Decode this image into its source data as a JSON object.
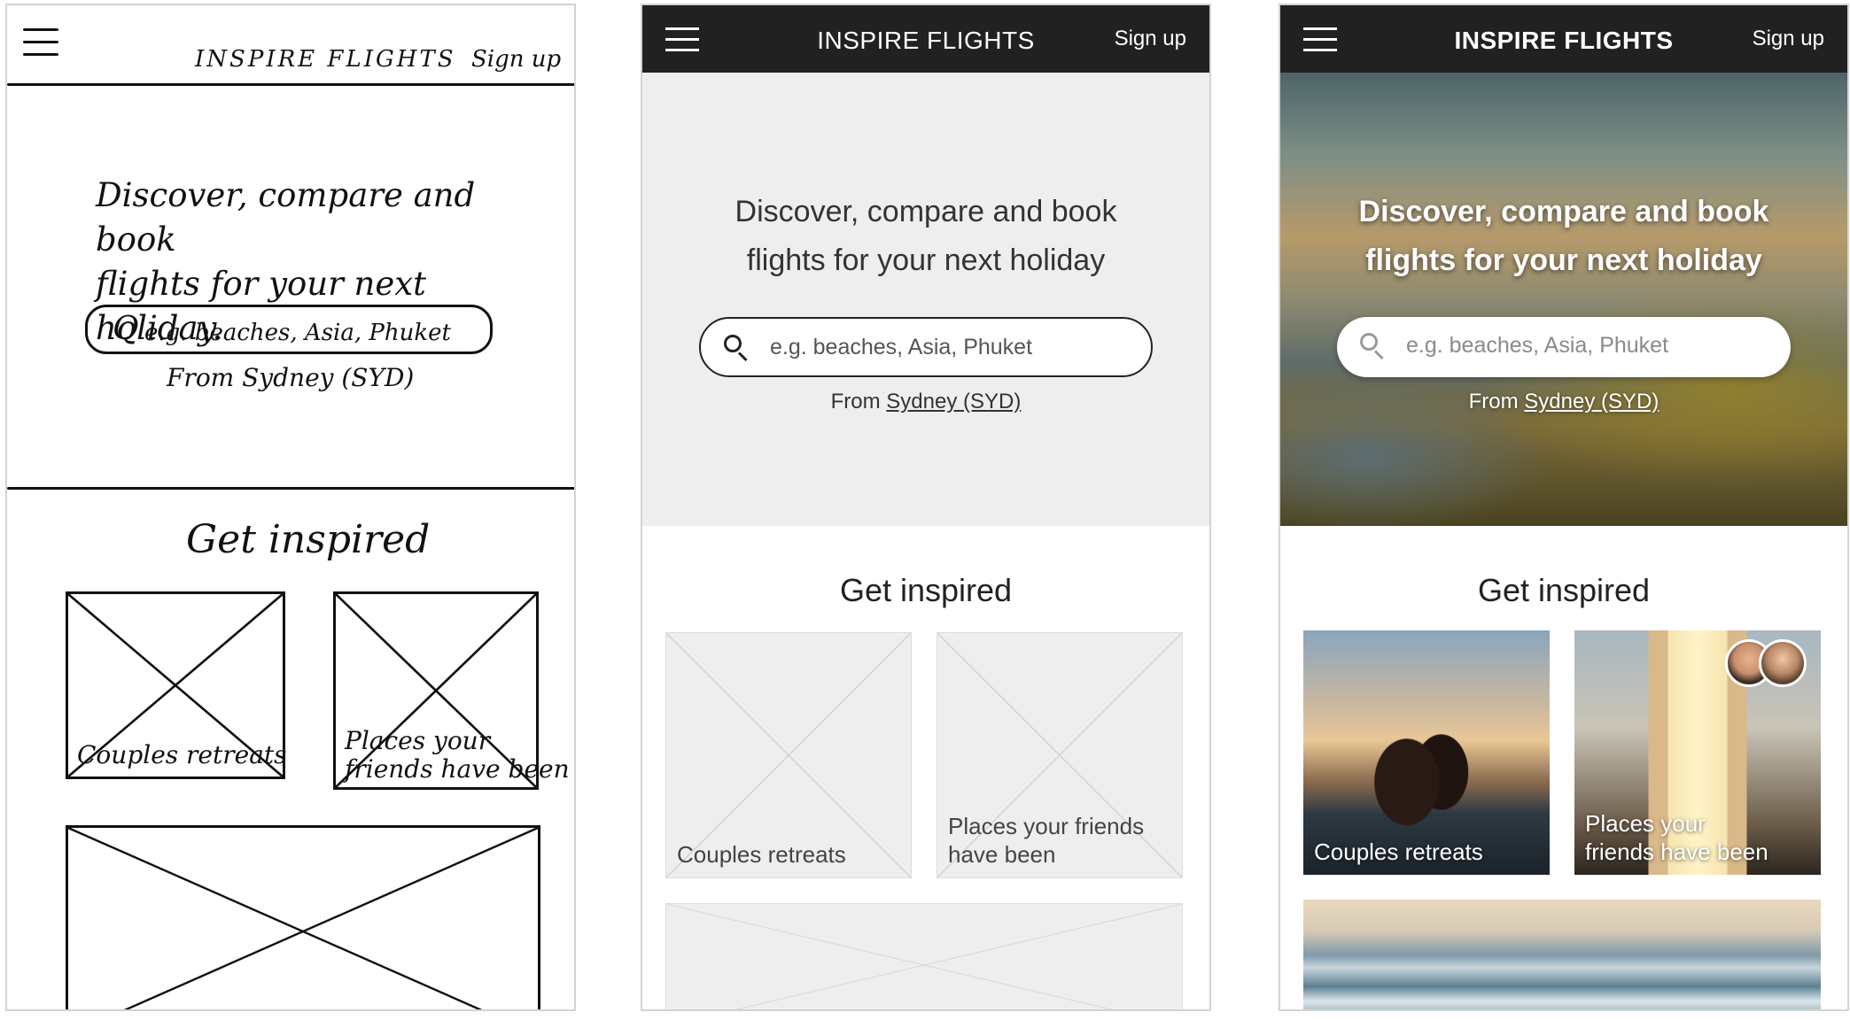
{
  "sketch": {
    "brand": "INSPIRE FLIGHTS",
    "signup": "Sign up",
    "headline_line1": "Discover, compare and book",
    "headline_line2": "flights for your next holiday.",
    "search_placeholder": "e.g. beaches, Asia, Phuket",
    "from_text": "From Sydney (SYD)",
    "section_title": "Get inspired",
    "card1_label": "Couples retreats",
    "card2_label_line1": "Places your",
    "card2_label_line2": "friends have been"
  },
  "wireframe": {
    "brand": "INSPIRE FLIGHTS",
    "signup": "Sign up",
    "headline_line1": "Discover, compare and book",
    "headline_line2": "flights for your next holiday",
    "search_placeholder": "e.g. beaches, Asia, Phuket",
    "from_prefix": "From",
    "from_link": "Sydney (SYD)",
    "section_title": "Get inspired",
    "card1_label": "Couples retreats",
    "card2_label_line1": "Places your friends",
    "card2_label_line2": "have been"
  },
  "final": {
    "brand": "INSPIRE FLIGHTS",
    "signup": "Sign up",
    "headline_line1": "Discover, compare and book",
    "headline_line2": "flights for your next holiday",
    "search_placeholder": "e.g. beaches, Asia, Phuket",
    "from_prefix": "From",
    "from_link": "Sydney (SYD)",
    "section_title": "Get inspired",
    "card1_label": "Couples retreats",
    "card2_label_line1": "Places your",
    "card2_label_line2": "friends have been"
  },
  "icons": {
    "menu": "hamburger-menu-icon",
    "search": "magnifier-search-icon",
    "placeholder_image": "image-placeholder-x",
    "friends": "friend-avatar"
  },
  "colors": {
    "nav_bar": "#212121",
    "wireframe_fill": "#eeeeee",
    "text_dark": "#222222",
    "text_light": "#ffffff"
  }
}
